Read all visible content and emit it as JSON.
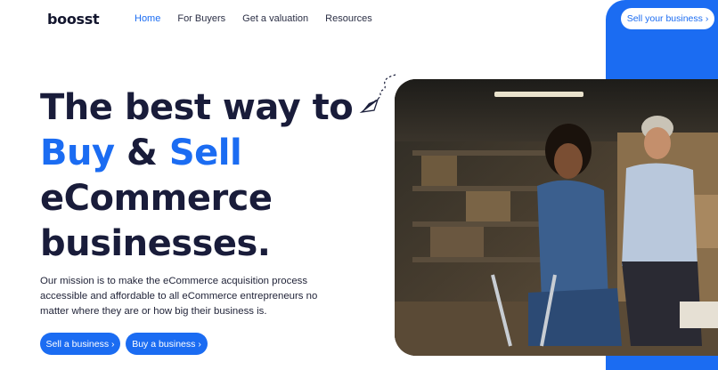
{
  "brand": {
    "logo_text": "boosst"
  },
  "nav": {
    "items": [
      {
        "label": "Home",
        "active": true
      },
      {
        "label": "For Buyers"
      },
      {
        "label": "Get a valuation"
      },
      {
        "label": "Resources"
      }
    ],
    "cta_label": "Sell your business ›"
  },
  "hero": {
    "line1": "The best way to",
    "buy": "Buy",
    "amp": "&",
    "sell": "Sell",
    "line3": "eCommerce",
    "line4": "businesses.",
    "mission": "Our mission is to make the eCommerce acquisition process accessible and affordable to all eCommerce entrepreneurs no matter where they are or how big their business is.",
    "sell_button": "Sell a business ›",
    "buy_button": "Buy a business ›"
  },
  "colors": {
    "accent": "#1b6cf2",
    "heading": "#191c3a"
  },
  "icons": [
    "paper-plane-icon"
  ]
}
